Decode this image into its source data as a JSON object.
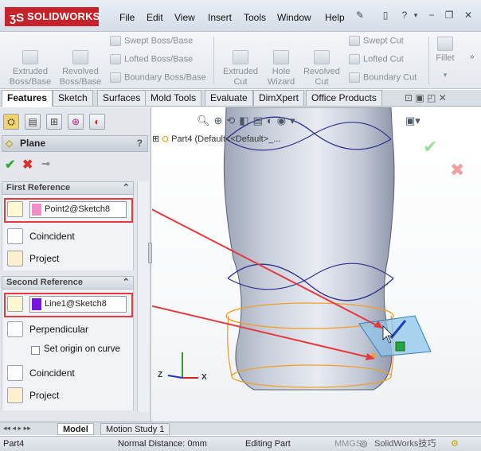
{
  "app": {
    "logo_text": "SOLIDWORKS"
  },
  "menu": [
    "File",
    "Edit",
    "View",
    "Insert",
    "Tools",
    "Window",
    "Help"
  ],
  "ribbon": {
    "extruded_boss": "Extruded\nBoss/Base",
    "revolved_boss": "Revolved\nBoss/Base",
    "swept_boss": "Swept Boss/Base",
    "lofted_boss": "Lofted Boss/Base",
    "boundary_boss": "Boundary Boss/Base",
    "extruded_cut": "Extruded\nCut",
    "hole_wizard": "Hole\nWizard",
    "revolved_cut": "Revolved\nCut",
    "swept_cut": "Swept Cut",
    "lofted_cut": "Lofted Cut",
    "boundary_cut": "Boundary Cut",
    "fillet": "Fillet"
  },
  "tabs": [
    "Features",
    "Sketch",
    "Surfaces",
    "Mold Tools",
    "Evaluate",
    "DimXpert",
    "Office Products"
  ],
  "property_manager": {
    "title": "Plane",
    "help": "?",
    "first_reference": {
      "header": "First Reference",
      "selection": "Point2@Sketch8",
      "swatch_color": "#f08cc8",
      "options": [
        "Coincident",
        "Project"
      ]
    },
    "second_reference": {
      "header": "Second Reference",
      "selection": "Line1@Sketch8",
      "swatch_color": "#7a12e0",
      "options": [
        "Perpendicular",
        "Set origin on curve",
        "Coincident",
        "Project"
      ]
    }
  },
  "tree": {
    "part_label": "Part4  (Default<<Default>_..."
  },
  "triad": {
    "z": "Z",
    "x": "X"
  },
  "bottom_tabs": [
    "Model",
    "Motion Study 1"
  ],
  "status": {
    "part": "Part4",
    "distance": "Normal Distance: 0mm",
    "mode": "Editing Part",
    "units": "MMGS"
  },
  "watermark": "SolidWorks技巧",
  "colors": {
    "accent_red": "#e5393f",
    "ok_green": "#3aa83a",
    "cancel_red": "#d8322f",
    "body_fill": "#c9cfdb",
    "sketch_orange": "#f2a02a",
    "curve_blue": "#2a2f8c"
  }
}
